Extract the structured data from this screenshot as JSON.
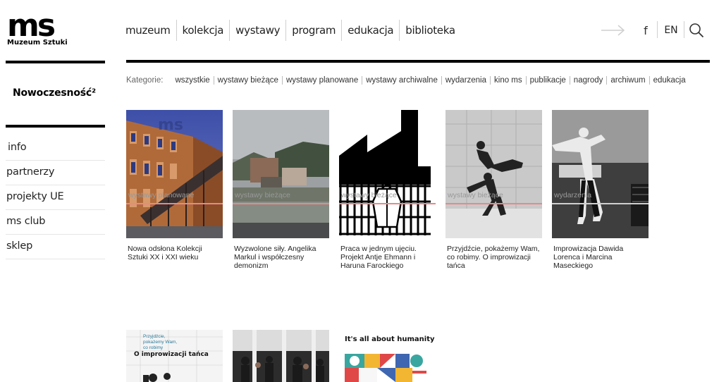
{
  "logo": {
    "mark": "ms",
    "subtitle": "Muzeum Sztuki"
  },
  "nav": {
    "items": [
      "muzeum",
      "kolekcja",
      "wystawy",
      "program",
      "edukacja",
      "biblioteka"
    ],
    "facebook": "f",
    "lang": "EN"
  },
  "sidebar": {
    "title": "Nowoczesność²",
    "items": [
      "info",
      "partnerzy",
      "projekty UE",
      "ms club",
      "sklep"
    ]
  },
  "categories": {
    "label": "Kategorie:",
    "items": [
      "wszystkie",
      "wystawy bieżące",
      "wystawy planowane",
      "wystawy archiwalne",
      "wydarzenia",
      "kino ms",
      "publikacje",
      "nagrody",
      "archiwum",
      "edukacja"
    ]
  },
  "cards": [
    {
      "title": "Nowa odsłona Kolekcji Sztuki XX i XXI wieku",
      "category": "wystawy planowane"
    },
    {
      "title": "Wyzwolone siły. Angelika Markul i współczesny demonizm",
      "category": "wystawy bieżące"
    },
    {
      "title": "Praca w jednym ujęciu. Projekt Antje Ehmann i Haruna Farockiego",
      "category": "wystawy bieżące"
    },
    {
      "title": "Przyjdźcie, pokażemy Wam, co robimy. O improwizacji tańca",
      "category": "wystawy bieżące"
    },
    {
      "title": "Improwizacja Dawida Lorenca i Marcina Maseckiego",
      "category": "wydarzenia"
    }
  ],
  "cards_row2": [
    {
      "poster_line1": "Przyjdźcie,",
      "poster_line2": "pokażemy Wam,",
      "poster_line3": "co robimy",
      "poster_title": "O improwizacji tańca"
    },
    {},
    {
      "poster_title": "It's all about humanity"
    }
  ],
  "colors": {
    "accent": "#e8888a",
    "text": "#222222",
    "rule": "#000000"
  }
}
